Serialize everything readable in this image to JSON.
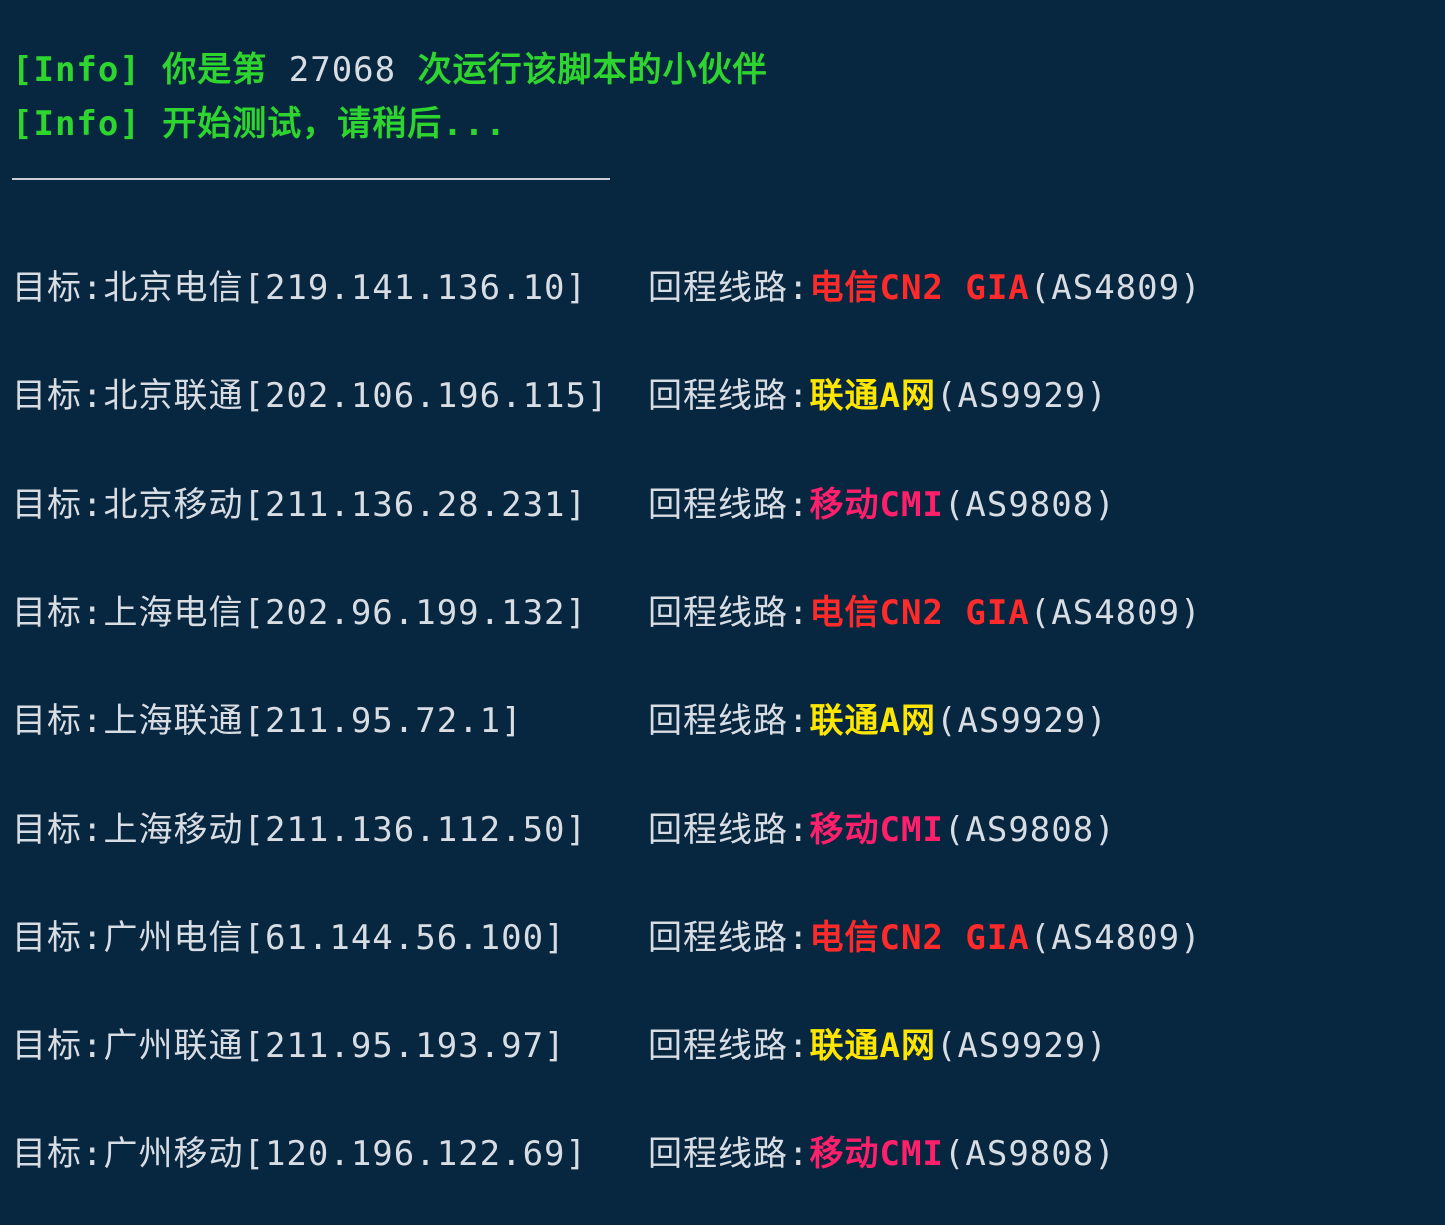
{
  "info": {
    "line1_prefix": "[Info] 你是第",
    "line1_count": " 27068 ",
    "line1_suffix": "次运行该脚本的小伙伴",
    "line2": "[Info] 开始测试，请稍后..."
  },
  "colors": {
    "background": "#072640",
    "text": "#d8dde4",
    "info_green": "#2ed52e",
    "telecom_red": "#ff2a2a",
    "unicom_yellow": "#ffe600",
    "mobile_pink": "#ff1f6b"
  },
  "rows": [
    {
      "target": "目标:北京电信[219.141.136.10]",
      "route_label": "回程线路:",
      "carrier": "电信CN2 GIA",
      "carrier_type": "telecom",
      "asn": "(AS4809)"
    },
    {
      "target": "目标:北京联通[202.106.196.115]",
      "route_label": "回程线路:",
      "carrier": "联通A网",
      "carrier_type": "unicom",
      "asn": "(AS9929)"
    },
    {
      "target": "目标:北京移动[211.136.28.231]",
      "route_label": "回程线路:",
      "carrier": "移动CMI",
      "carrier_type": "mobile",
      "asn": "(AS9808)"
    },
    {
      "target": "目标:上海电信[202.96.199.132]",
      "route_label": "回程线路:",
      "carrier": "电信CN2 GIA",
      "carrier_type": "telecom",
      "asn": "(AS4809)"
    },
    {
      "target": "目标:上海联通[211.95.72.1]",
      "route_label": "回程线路:",
      "carrier": "联通A网",
      "carrier_type": "unicom",
      "asn": "(AS9929)"
    },
    {
      "target": "目标:上海移动[211.136.112.50]",
      "route_label": "回程线路:",
      "carrier": "移动CMI",
      "carrier_type": "mobile",
      "asn": "(AS9808)"
    },
    {
      "target": "目标:广州电信[61.144.56.100]",
      "route_label": "回程线路:",
      "carrier": "电信CN2 GIA",
      "carrier_type": "telecom",
      "asn": "(AS4809)"
    },
    {
      "target": "目标:广州联通[211.95.193.97]",
      "route_label": "回程线路:",
      "carrier": "联通A网",
      "carrier_type": "unicom",
      "asn": "(AS9929)"
    },
    {
      "target": "目标:广州移动[120.196.122.69]",
      "route_label": "回程线路:",
      "carrier": "移动CMI",
      "carrier_type": "mobile",
      "asn": "(AS9808)"
    }
  ]
}
